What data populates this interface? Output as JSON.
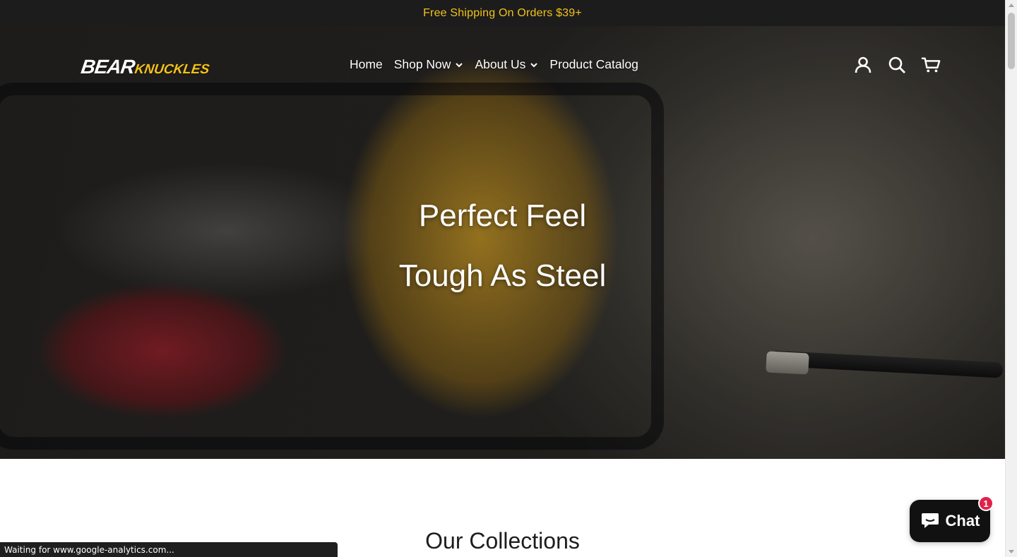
{
  "announcement": {
    "text": "Free Shipping On Orders $39+"
  },
  "brand": {
    "logo_bear": "BEAR",
    "logo_knuckles": "KNUCKLES",
    "accent": "#f2c21a"
  },
  "nav": {
    "items": [
      {
        "label": "Home",
        "has_dropdown": false
      },
      {
        "label": "Shop Now",
        "has_dropdown": true
      },
      {
        "label": "About Us",
        "has_dropdown": true
      },
      {
        "label": "Product Catalog",
        "has_dropdown": false
      }
    ]
  },
  "header_icons": [
    "account-icon",
    "search-icon",
    "cart-icon"
  ],
  "hero": {
    "line1": "Perfect Feel",
    "line2": "Tough As Steel"
  },
  "collections": {
    "title": "Our Collections"
  },
  "chat": {
    "label": "Chat",
    "badge_count": "1"
  },
  "browser_status": {
    "text": "Waiting for www.google-analytics.com..."
  }
}
